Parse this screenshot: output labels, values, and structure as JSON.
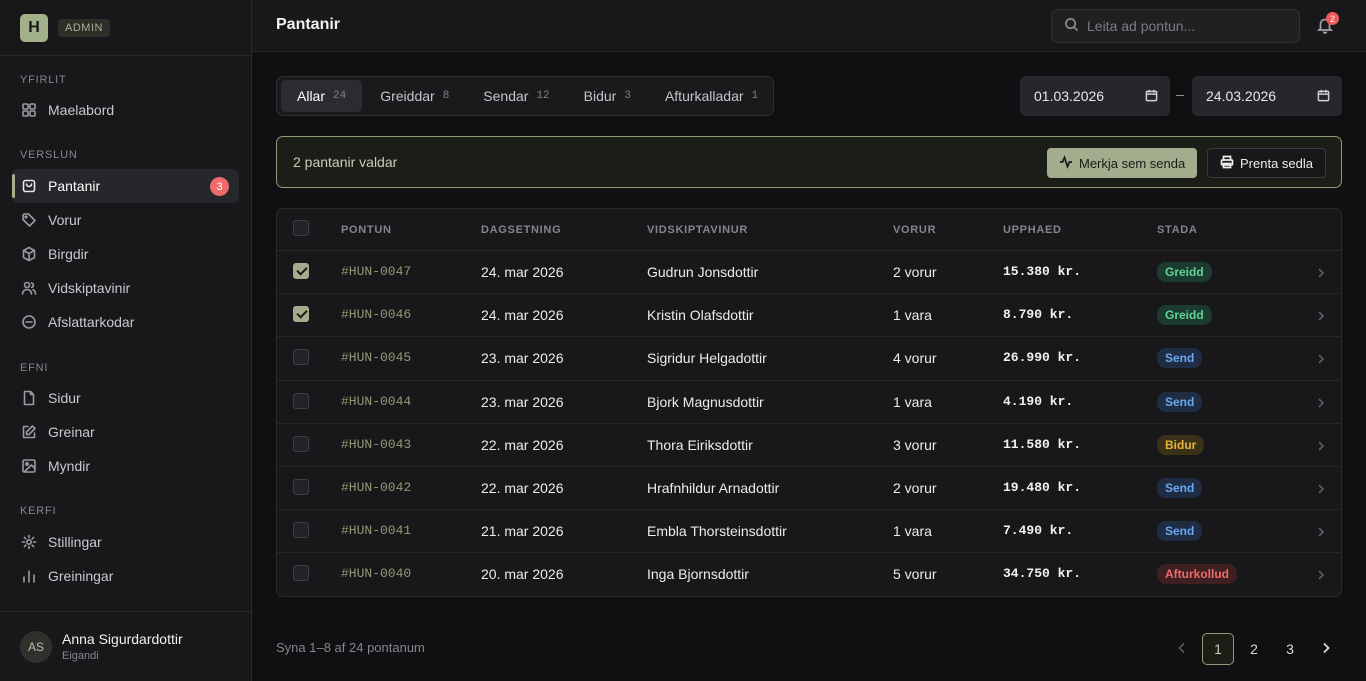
{
  "brand": {
    "logo_letter": "H",
    "badge": "ADMIN"
  },
  "sidebar": {
    "sections": [
      {
        "heading": "YFIRLIT",
        "items": [
          {
            "label": "Maelabord",
            "icon": "grid-icon"
          }
        ]
      },
      {
        "heading": "VERSLUN",
        "items": [
          {
            "label": "Pantanir",
            "icon": "bag-icon",
            "active": true,
            "badge": "3"
          },
          {
            "label": "Vorur",
            "icon": "tag-icon"
          },
          {
            "label": "Birgdir",
            "icon": "box-icon"
          },
          {
            "label": "Vidskiptavinir",
            "icon": "users-icon"
          },
          {
            "label": "Afslattarkodar",
            "icon": "discount-icon"
          }
        ]
      },
      {
        "heading": "EFNI",
        "items": [
          {
            "label": "Sidur",
            "icon": "page-icon"
          },
          {
            "label": "Greinar",
            "icon": "edit-icon"
          },
          {
            "label": "Myndir",
            "icon": "image-icon"
          }
        ]
      },
      {
        "heading": "KERFI",
        "items": [
          {
            "label": "Stillingar",
            "icon": "gear-icon"
          },
          {
            "label": "Greiningar",
            "icon": "bar-chart-icon"
          }
        ]
      }
    ]
  },
  "user": {
    "initials": "AS",
    "name": "Anna Sigurdardottir",
    "role": "Eigandi"
  },
  "topbar": {
    "title": "Pantanir",
    "search_placeholder": "Leita ad pontun...",
    "notification_count": "2"
  },
  "filters": {
    "tabs": [
      {
        "label": "Allar",
        "count": "24",
        "active": true
      },
      {
        "label": "Greiddar",
        "count": "8"
      },
      {
        "label": "Sendar",
        "count": "12"
      },
      {
        "label": "Bidur",
        "count": "3"
      },
      {
        "label": "Afturkalladar",
        "count": "1"
      }
    ],
    "date_from": "01.03.2026",
    "date_sep": "–",
    "date_to": "24.03.2026"
  },
  "selection": {
    "text": "2 pantanir valdar",
    "mark_sent_label": "Merkja sem senda",
    "print_label": "Prenta sedla"
  },
  "table": {
    "headers": {
      "order": "PONTUN",
      "date": "DAGSETNING",
      "customer": "VIDSKIPTAVINUR",
      "items": "VORUR",
      "amount": "UPPHAED",
      "status": "STADA"
    },
    "rows": [
      {
        "checked": true,
        "id": "#HUN-0047",
        "date": "24. mar 2026",
        "customer": "Gudrun Jonsdottir",
        "items": "2 vorur",
        "amount": "15.380 kr.",
        "status": "Greidd",
        "status_kind": "greidd"
      },
      {
        "checked": true,
        "id": "#HUN-0046",
        "date": "24. mar 2026",
        "customer": "Kristin Olafsdottir",
        "items": "1 vara",
        "amount": "8.790 kr.",
        "status": "Greidd",
        "status_kind": "greidd"
      },
      {
        "checked": false,
        "id": "#HUN-0045",
        "date": "23. mar 2026",
        "customer": "Sigridur Helgadottir",
        "items": "4 vorur",
        "amount": "26.990 kr.",
        "status": "Send",
        "status_kind": "send"
      },
      {
        "checked": false,
        "id": "#HUN-0044",
        "date": "23. mar 2026",
        "customer": "Bjork Magnusdottir",
        "items": "1 vara",
        "amount": "4.190 kr.",
        "status": "Send",
        "status_kind": "send"
      },
      {
        "checked": false,
        "id": "#HUN-0043",
        "date": "22. mar 2026",
        "customer": "Thora Eiriksdottir",
        "items": "3 vorur",
        "amount": "11.580 kr.",
        "status": "Bidur",
        "status_kind": "bidur"
      },
      {
        "checked": false,
        "id": "#HUN-0042",
        "date": "22. mar 2026",
        "customer": "Hrafnhildur Arnadottir",
        "items": "2 vorur",
        "amount": "19.480 kr.",
        "status": "Send",
        "status_kind": "send"
      },
      {
        "checked": false,
        "id": "#HUN-0041",
        "date": "21. mar 2026",
        "customer": "Embla Thorsteinsdottir",
        "items": "1 vara",
        "amount": "7.490 kr.",
        "status": "Send",
        "status_kind": "send"
      },
      {
        "checked": false,
        "id": "#HUN-0040",
        "date": "20. mar 2026",
        "customer": "Inga Bjornsdottir",
        "items": "5 vorur",
        "amount": "34.750 kr.",
        "status": "Afturkollud",
        "status_kind": "aftur"
      }
    ]
  },
  "pagination": {
    "range_text": "Syna 1–8 af 24 pontanum",
    "pages": [
      "1",
      "2",
      "3"
    ],
    "current": "1"
  },
  "colors": {
    "accent": "#a3b18a",
    "background": "#101012",
    "panel": "#18181b",
    "badge_red": "#ef6b6b"
  }
}
